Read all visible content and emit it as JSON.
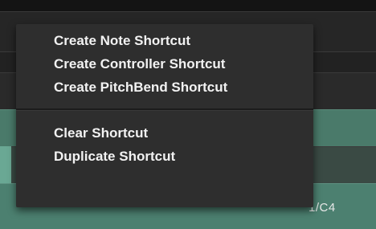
{
  "menu": {
    "items_group1": [
      {
        "label": "Create Note Shortcut"
      },
      {
        "label": "Create Controller Shortcut"
      },
      {
        "label": "Create PitchBend Shortcut"
      }
    ],
    "items_group2": [
      {
        "label": "Clear Shortcut"
      },
      {
        "label": "Duplicate Shortcut"
      }
    ]
  },
  "background": {
    "cell_value": "1/C4"
  }
}
